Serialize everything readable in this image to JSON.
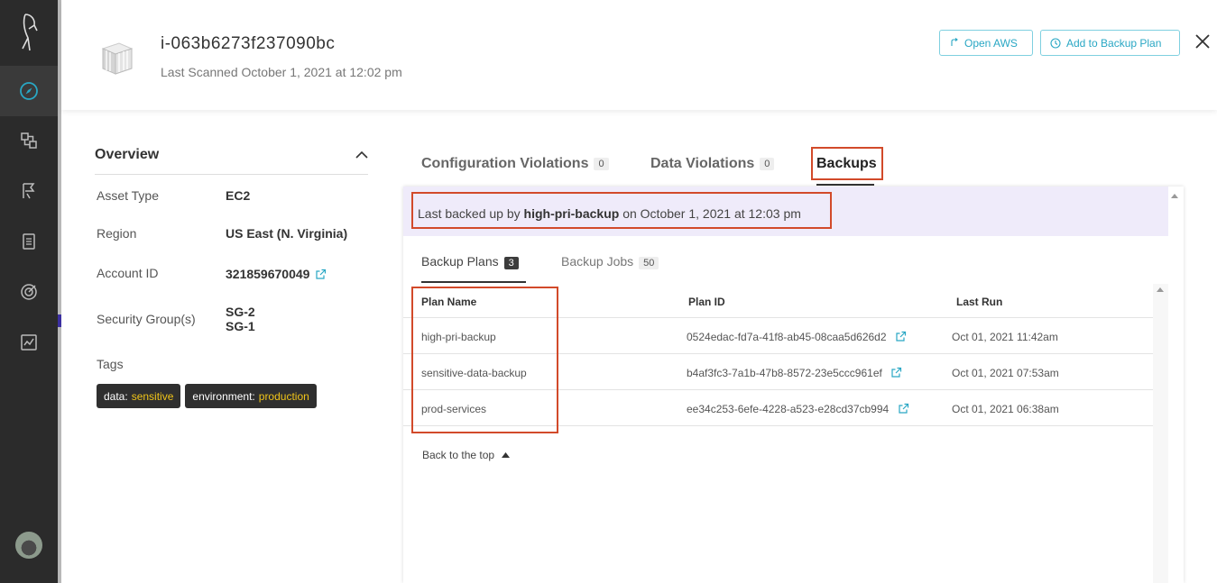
{
  "nav": {
    "items": [
      {
        "icon": "compass-icon",
        "active": true
      },
      {
        "icon": "network-icon",
        "active": false
      },
      {
        "icon": "flag-icon",
        "active": false
      },
      {
        "icon": "document-icon",
        "active": false
      },
      {
        "icon": "target-icon",
        "active": false
      },
      {
        "icon": "chart-icon",
        "active": false
      }
    ]
  },
  "header": {
    "title": "i-063b6273f237090bc",
    "subtitle": "Last Scanned October 1, 2021 at 12:02 pm",
    "open_aws": "Open AWS",
    "add_backup_plan": "Add to Backup Plan"
  },
  "overview": {
    "title": "Overview",
    "fields": [
      {
        "label": "Asset Type",
        "value": "EC2"
      },
      {
        "label": "Region",
        "value": "US East (N. Virginia)"
      },
      {
        "label": "Account ID",
        "value": "321859670049"
      },
      {
        "label": "Security Group(s)",
        "value1": "SG-2",
        "value2": "SG-1"
      }
    ],
    "tags_label": "Tags",
    "tags": [
      {
        "key": "data:",
        "value": "sensitive"
      },
      {
        "key": "environment:",
        "value": "production"
      }
    ]
  },
  "tabs": [
    {
      "label": "Configuration Violations",
      "count": "0"
    },
    {
      "label": "Data Violations",
      "count": "0"
    },
    {
      "label": "Backups"
    }
  ],
  "banner": {
    "prefix": "Last backed up by",
    "plan": "high-pri-backup",
    "suffix": "on October 1, 2021 at 12:03 pm"
  },
  "subtabs": [
    {
      "label": "Backup Plans",
      "count": "3"
    },
    {
      "label": "Backup Jobs",
      "count": "50"
    }
  ],
  "table": {
    "headers": [
      "Plan Name",
      "Plan ID",
      "Last Run"
    ],
    "rows": [
      {
        "name": "high-pri-backup",
        "id": "0524edac-fd7a-41f8-ab45-08caa5d626d2",
        "last_run": "Oct 01, 2021 11:42am"
      },
      {
        "name": "sensitive-data-backup",
        "id": "b4af3fc3-7a1b-47b8-8572-23e5ccc961ef",
        "last_run": "Oct 01, 2021 07:53am"
      },
      {
        "name": "prod-services",
        "id": "ee34c253-6efe-4228-a523-e28cd37cb994",
        "last_run": "Oct 01, 2021 06:38am"
      }
    ]
  },
  "back_to_top": "Back to the top",
  "colors": {
    "accent": "#29a7c4",
    "highlight": "#d24a2a",
    "tag_value": "#f0c419",
    "banner": "#efebfa"
  }
}
